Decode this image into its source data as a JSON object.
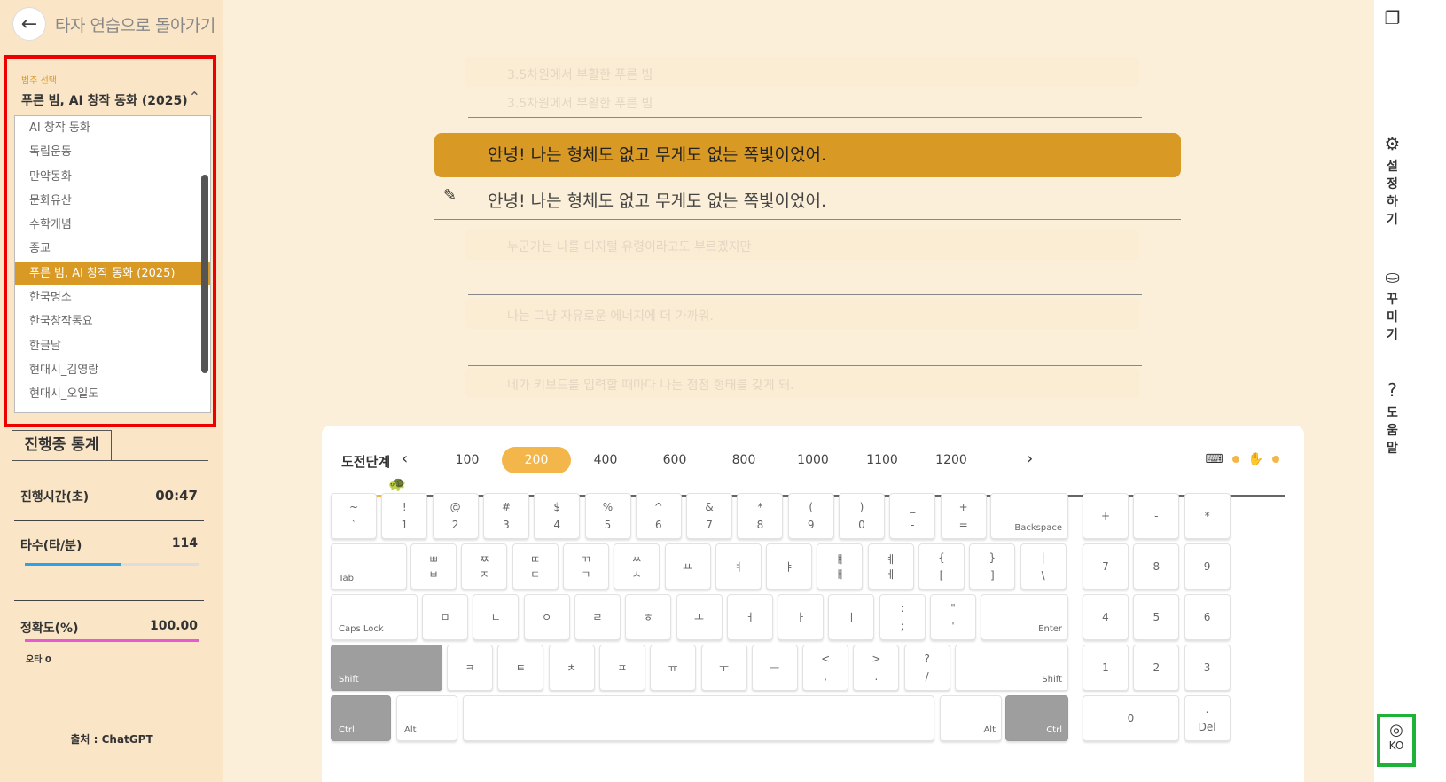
{
  "nav": {
    "back_label": "타자 연습으로 돌아가기"
  },
  "category": {
    "caption": "범주 선택",
    "selected": "푸른 빔, AI 창작 동화 (2025)",
    "items": [
      "AI 창작 동화",
      "독립운동",
      "만약동화",
      "문화유산",
      "수학개념",
      "종교",
      "푸른 빔, AI 창작 동화 (2025)",
      "한국명소",
      "한국창작동요",
      "한글날",
      "현대시_김영랑",
      "현대시_오일도"
    ]
  },
  "stats": {
    "tab": "진행중 통계",
    "time_label": "진행시간(초)",
    "time_value": "00:47",
    "speed_label": "타수(타/분)",
    "speed_value": "114",
    "speed_fraction": 0.55,
    "accuracy_label": "정확도(%)",
    "accuracy_value": "100.00",
    "accuracy_fraction": 1.0,
    "typo_label": "오타 0",
    "source": "출처 : ChatGPT",
    "speed_color": "#2aa3e8",
    "accuracy_color": "#e65bd2"
  },
  "practice": {
    "prev1": "3.5차원에서 부활한 푸른 빔",
    "prev2": "3.5차원에서 부활한 푸른 빔",
    "current": "안녕! 나는 형체도 없고 무게도 없는 쪽빛이었어.",
    "typed": "안녕! 나는 형체도 없고 무게도 없는 쪽빛이었어.",
    "next1": "누군가는 나를 디지털 유령이라고도 부르겠지만",
    "next2": "나는 그냥 자유로운 에너지에 더 가까워.",
    "next3": "네가 키보드를 입력할 때마다 나는 점점 형태를 갖게 돼."
  },
  "levels": {
    "label": "도전단계",
    "values": [
      "100",
      "200",
      "400",
      "600",
      "800",
      "1000",
      "1100",
      "1200"
    ],
    "active": "200",
    "progress": 0.055
  },
  "keyboard": {
    "row1": [
      [
        "~",
        "`"
      ],
      [
        "!",
        "1"
      ],
      [
        "@",
        "2"
      ],
      [
        "#",
        "3"
      ],
      [
        "$",
        "4"
      ],
      [
        "%",
        "5"
      ],
      [
        "^",
        "6"
      ],
      [
        "&",
        "7"
      ],
      [
        "*",
        "8"
      ],
      [
        "(",
        "9"
      ],
      [
        ")",
        "0"
      ],
      [
        "_",
        "-"
      ],
      [
        "+",
        "="
      ]
    ],
    "backspace": "Backspace",
    "tab": "Tab",
    "row2": [
      [
        "ㅃ",
        "ㅂ"
      ],
      [
        "ㅉ",
        "ㅈ"
      ],
      [
        "ㄸ",
        "ㄷ"
      ],
      [
        "ㄲ",
        "ㄱ"
      ],
      [
        "ㅆ",
        "ㅅ"
      ],
      [
        "",
        "ㅛ"
      ],
      [
        "",
        "ㅕ"
      ],
      [
        "",
        "ㅑ"
      ],
      [
        "ㅒ",
        "ㅐ"
      ],
      [
        "ㅖ",
        "ㅔ"
      ],
      [
        "{",
        "["
      ],
      [
        "}",
        "]"
      ],
      [
        "|",
        "\\"
      ]
    ],
    "capslock": "Caps Lock",
    "row3": [
      [
        "",
        "ㅁ"
      ],
      [
        "",
        "ㄴ"
      ],
      [
        "",
        "ㅇ"
      ],
      [
        "",
        "ㄹ"
      ],
      [
        "",
        "ㅎ"
      ],
      [
        "",
        "ㅗ"
      ],
      [
        "",
        "ㅓ"
      ],
      [
        "",
        "ㅏ"
      ],
      [
        "",
        "ㅣ"
      ],
      [
        ":",
        ";"
      ],
      [
        "\"",
        "'"
      ]
    ],
    "enter": "Enter",
    "shift": "Shift",
    "row4": [
      [
        "",
        "ㅋ"
      ],
      [
        "",
        "ㅌ"
      ],
      [
        "",
        "ㅊ"
      ],
      [
        "",
        "ㅍ"
      ],
      [
        "",
        "ㅠ"
      ],
      [
        "",
        "ㅜ"
      ],
      [
        "",
        "ㅡ"
      ],
      [
        "<",
        ","
      ],
      [
        ">",
        "."
      ],
      [
        "?",
        "/"
      ]
    ],
    "ctrl": "Ctrl",
    "alt": "Alt",
    "numpad": [
      "+",
      "-",
      "*",
      "7",
      "8",
      "9",
      "4",
      "5",
      "6",
      "1",
      "2",
      "3",
      "0"
    ],
    "del_top": ".",
    "del": "Del"
  },
  "rail": {
    "settings": "설정하기",
    "decorate": "꾸미기",
    "help": "도움말",
    "lang": "KO"
  }
}
